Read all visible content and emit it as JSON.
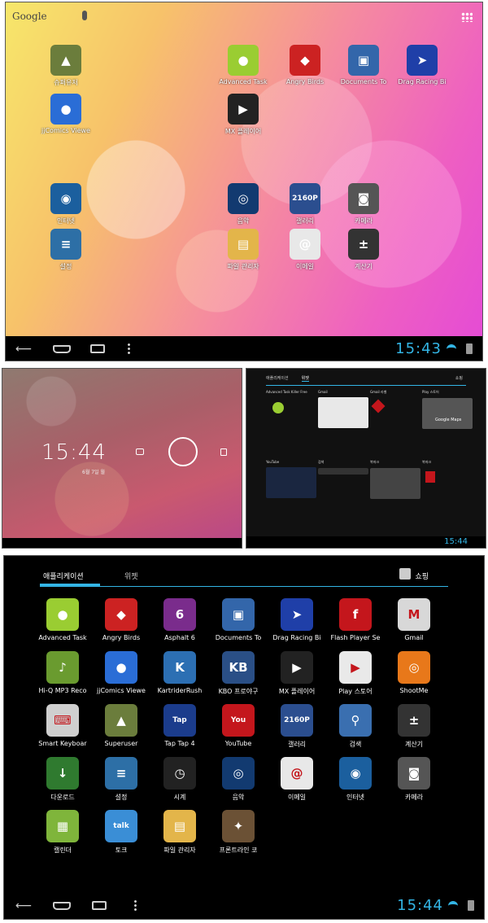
{
  "home": {
    "search_label": "Google",
    "apps": [
      {
        "label": "슈퍼유저",
        "icon": "android-superuser-icon",
        "color": "#6b7d3c",
        "glyph": "▲"
      },
      {
        "label": "Advanced Task",
        "icon": "android-robot-icon",
        "color": "#9acd32",
        "glyph": "●"
      },
      {
        "label": "Angry Birds",
        "icon": "angry-bird-icon",
        "color": "#cc2222",
        "glyph": "◆"
      },
      {
        "label": "Documents To",
        "icon": "documents-icon",
        "color": "#3366aa",
        "glyph": "▣"
      },
      {
        "label": "Drag Racing Bi",
        "icon": "motorbike-icon",
        "color": "#1f3fa8",
        "glyph": "➤"
      },
      {
        "label": "jjComics Viewe",
        "icon": "chat-bubble-icon",
        "color": "#2a6dd6",
        "glyph": "●"
      },
      {
        "label": "MX 플레이어",
        "icon": "play-icon",
        "color": "#222",
        "glyph": "▶"
      },
      {
        "label": "인터넷",
        "icon": "globe-icon",
        "color": "#1b5f9e",
        "glyph": "◉"
      },
      {
        "label": "음악",
        "icon": "speaker-icon",
        "color": "#123a70",
        "glyph": "◎"
      },
      {
        "label": "갤러리",
        "icon": "gallery-icon",
        "color": "#2b4e8f",
        "glyph": "2160P"
      },
      {
        "label": "카메라",
        "icon": "camera-icon",
        "color": "#555",
        "glyph": "◙"
      },
      {
        "label": "설정",
        "icon": "settings-icon",
        "color": "#2d6fa6",
        "glyph": "≡"
      },
      {
        "label": "파일 관리자",
        "icon": "folder-icon",
        "color": "#e3b54a",
        "glyph": "▤"
      },
      {
        "label": "이메일",
        "icon": "email-icon",
        "color": "#e8e8e8",
        "glyph": "@"
      },
      {
        "label": "계산기",
        "icon": "calculator-icon",
        "color": "#333",
        "glyph": "±"
      }
    ],
    "clock": "15:43"
  },
  "lock": {
    "time": "15:44",
    "date": "6월 7일 월"
  },
  "widgets": {
    "tabs": [
      "애플리케이션",
      "위젯"
    ],
    "shop": "쇼핑",
    "cells": [
      "Advanced Task Killer Free",
      "Gmail",
      "Gmail 라벨",
      "Play 스토어",
      "YouTube",
      "검색",
      "북마크",
      "북마크"
    ],
    "maps_label": "Google Maps",
    "clock": "15:44"
  },
  "drawer": {
    "tab_apps": "애플리케이션",
    "tab_widgets": "위젯",
    "shop": "쇼핑",
    "apps": [
      {
        "label": "Advanced Task",
        "icon": "android-robot-icon",
        "color": "#9acd32",
        "glyph": "●"
      },
      {
        "label": "Angry Birds",
        "icon": "angry-bird-icon",
        "color": "#cc2222",
        "glyph": "◆"
      },
      {
        "label": "Asphalt 6",
        "icon": "asphalt-icon",
        "color": "#7a2c8c",
        "glyph": "6"
      },
      {
        "label": "Documents To",
        "icon": "documents-icon",
        "color": "#3366aa",
        "glyph": "▣"
      },
      {
        "label": "Drag Racing Bi",
        "icon": "motorbike-icon",
        "color": "#1f3fa8",
        "glyph": "➤"
      },
      {
        "label": "Flash Player Se",
        "icon": "flash-icon",
        "color": "#c4161c",
        "glyph": "f"
      },
      {
        "label": "Gmail",
        "icon": "gmail-icon",
        "color": "#d8d8d8",
        "glyph": "M"
      },
      {
        "label": "Hi-Q MP3 Reco",
        "icon": "microphone-icon",
        "color": "#6a9b2f",
        "glyph": "♪"
      },
      {
        "label": "jjComics Viewe",
        "icon": "chat-bubble-icon",
        "color": "#2a6dd6",
        "glyph": "●"
      },
      {
        "label": "KartriderRush",
        "icon": "kart-icon",
        "color": "#2c6fb3",
        "glyph": "K"
      },
      {
        "label": "KBO 프로야구",
        "icon": "baseball-icon",
        "color": "#2a4f86",
        "glyph": "KB"
      },
      {
        "label": "MX 플레이어",
        "icon": "play-icon",
        "color": "#222",
        "glyph": "▶"
      },
      {
        "label": "Play 스토어",
        "icon": "store-bag-icon",
        "color": "#e9e9e9",
        "glyph": "▶"
      },
      {
        "label": "ShootMe",
        "icon": "shootme-icon",
        "color": "#e8781a",
        "glyph": "◎"
      },
      {
        "label": "Smart Keyboar",
        "icon": "keyboard-icon",
        "color": "#cfcfcf",
        "glyph": "⌨"
      },
      {
        "label": "Superuser",
        "icon": "android-superuser-icon",
        "color": "#6b7d3c",
        "glyph": "▲"
      },
      {
        "label": "Tap Tap 4",
        "icon": "taptap-icon",
        "color": "#1b3c8c",
        "glyph": "Tap"
      },
      {
        "label": "YouTube",
        "icon": "youtube-icon",
        "color": "#c4161c",
        "glyph": "You"
      },
      {
        "label": "갤러리",
        "icon": "gallery-icon",
        "color": "#2b4e8f",
        "glyph": "2160P"
      },
      {
        "label": "검색",
        "icon": "magnifier-icon",
        "color": "#3a6fb0",
        "glyph": "⚲"
      },
      {
        "label": "계산기",
        "icon": "calculator-icon",
        "color": "#333",
        "glyph": "±"
      },
      {
        "label": "다운로드",
        "icon": "download-icon",
        "color": "#2f7a2f",
        "glyph": "↓"
      },
      {
        "label": "설정",
        "icon": "settings-icon",
        "color": "#2d6fa6",
        "glyph": "≡"
      },
      {
        "label": "시계",
        "icon": "clock-icon",
        "color": "#222",
        "glyph": "◷"
      },
      {
        "label": "음악",
        "icon": "speaker-icon",
        "color": "#123a70",
        "glyph": "◎"
      },
      {
        "label": "이메일",
        "icon": "email-icon",
        "color": "#e8e8e8",
        "glyph": "@"
      },
      {
        "label": "인터넷",
        "icon": "globe-icon",
        "color": "#1b5f9e",
        "glyph": "◉"
      },
      {
        "label": "카메라",
        "icon": "camera-icon",
        "color": "#555",
        "glyph": "◙"
      },
      {
        "label": "캘린더",
        "icon": "calendar-icon",
        "color": "#7fb53b",
        "glyph": "▦"
      },
      {
        "label": "토크",
        "icon": "talk-icon",
        "color": "#3a8ed6",
        "glyph": "talk"
      },
      {
        "label": "파일 관리자",
        "icon": "folder-icon",
        "color": "#e3b54a",
        "glyph": "▤"
      },
      {
        "label": "프론트라인 코",
        "icon": "frontline-icon",
        "color": "#6b5135",
        "glyph": "✦"
      }
    ],
    "clock": "15:44"
  }
}
